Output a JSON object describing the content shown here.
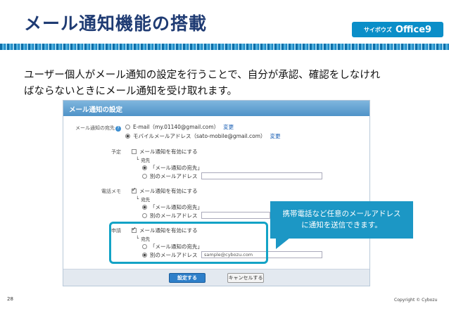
{
  "header": {
    "title": "メール通知機能の搭載",
    "logo_small": "サイボウズ",
    "logo_main": "Office9"
  },
  "intro": {
    "line1": "ユーザー個人がメール通知の設定を行うことで、自分が承認、確認をしなけれ",
    "line2": "ばならないときにメール通知を受け取れます。"
  },
  "panel": {
    "title": "メール通知の設定",
    "recipient": {
      "label": "メール通知の宛先",
      "option1": "E-mail（my.01140@gmail.com）",
      "option2": "モバイルメールアドレス（sato-mobile@gmail.com）",
      "change_link": "変更"
    },
    "sections": [
      {
        "label": "予定",
        "enable": "メール通知を有効にする",
        "dest_label": "宛先",
        "opt_default": "「メール通知の宛先」",
        "opt_other": "別のメールアドレス",
        "other_value": ""
      },
      {
        "label": "電話メモ",
        "enable": "メール通知を有効にする",
        "dest_label": "宛先",
        "opt_default": "「メール通知の宛先」",
        "opt_other": "別のメールアドレス",
        "other_value": ""
      },
      {
        "label": "申請",
        "enable": "メール通知を有効にする",
        "dest_label": "宛先",
        "opt_default": "「メール通知の宛先」",
        "opt_other": "別のメールアドレス",
        "other_value": "sample@cybozu.com"
      }
    ],
    "save_label": "設定する",
    "cancel_label": "キャンセルする"
  },
  "callout": {
    "line1": "携帯電話など任意のメールアドレス",
    "line2": "に通知を送信できます。"
  },
  "footer": {
    "page_number": "28",
    "copyright": "Copyright © Cybozu"
  },
  "colors": {
    "title": "#1f3b73",
    "accent": "#1c97c5",
    "panel_header": "#4f93c8"
  }
}
